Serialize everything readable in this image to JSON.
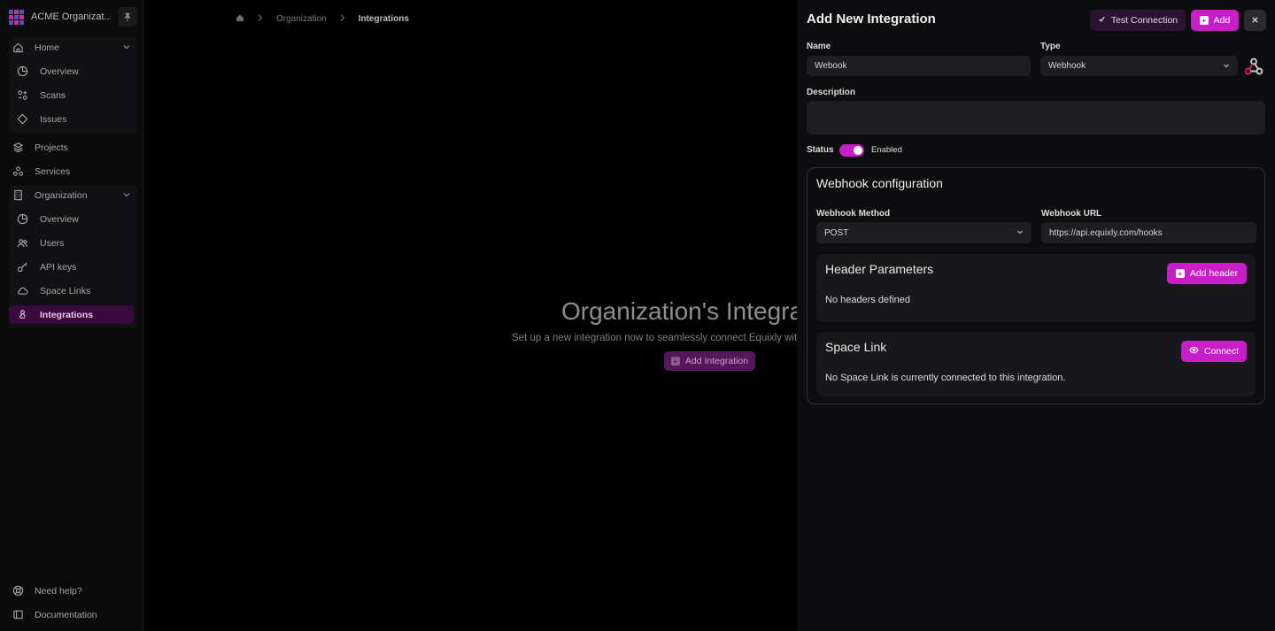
{
  "org": {
    "name": "ACME Organizat..."
  },
  "sidebar": {
    "home_group": {
      "label": "Home",
      "items": [
        {
          "label": "Overview"
        },
        {
          "label": "Scans"
        },
        {
          "label": "Issues"
        }
      ]
    },
    "projects": "Projects",
    "services": "Services",
    "org_group": {
      "label": "Organization",
      "items": [
        {
          "label": "Overview"
        },
        {
          "label": "Users"
        },
        {
          "label": "API keys"
        },
        {
          "label": "Space Links"
        },
        {
          "label": "Integrations"
        }
      ]
    },
    "help": "Need help?",
    "docs": "Documentation"
  },
  "breadcrumb": {
    "parent": "Organization",
    "current": "Integrations"
  },
  "empty_state": {
    "title": "Organization's Integra",
    "subtitle": "Set up a new integration now to seamlessly connect Equixly with",
    "button": "Add Integration"
  },
  "panel": {
    "title": "Add New Integration",
    "test_button": "Test Connection",
    "add_button": "Add",
    "name_label": "Name",
    "name_value": "Webook",
    "type_label": "Type",
    "type_value": "Webhook",
    "description_label": "Description",
    "description_value": "",
    "status_label": "Status",
    "status_value": "Enabled",
    "config": {
      "title": "Webhook configuration",
      "method_label": "Webhook Method",
      "method_value": "POST",
      "url_label": "Webhook URL",
      "url_value": "https://api.equixly.com/hooks",
      "headers_title": "Header Parameters",
      "headers_button": "Add header",
      "headers_empty": "No headers defined",
      "space_title": "Space Link",
      "space_button": "Connect",
      "space_empty": "No Space Link is currently connected to this integration."
    }
  },
  "colors": {
    "accent": "#c71ec7",
    "active_nav_bg": "#3a0a3e"
  }
}
